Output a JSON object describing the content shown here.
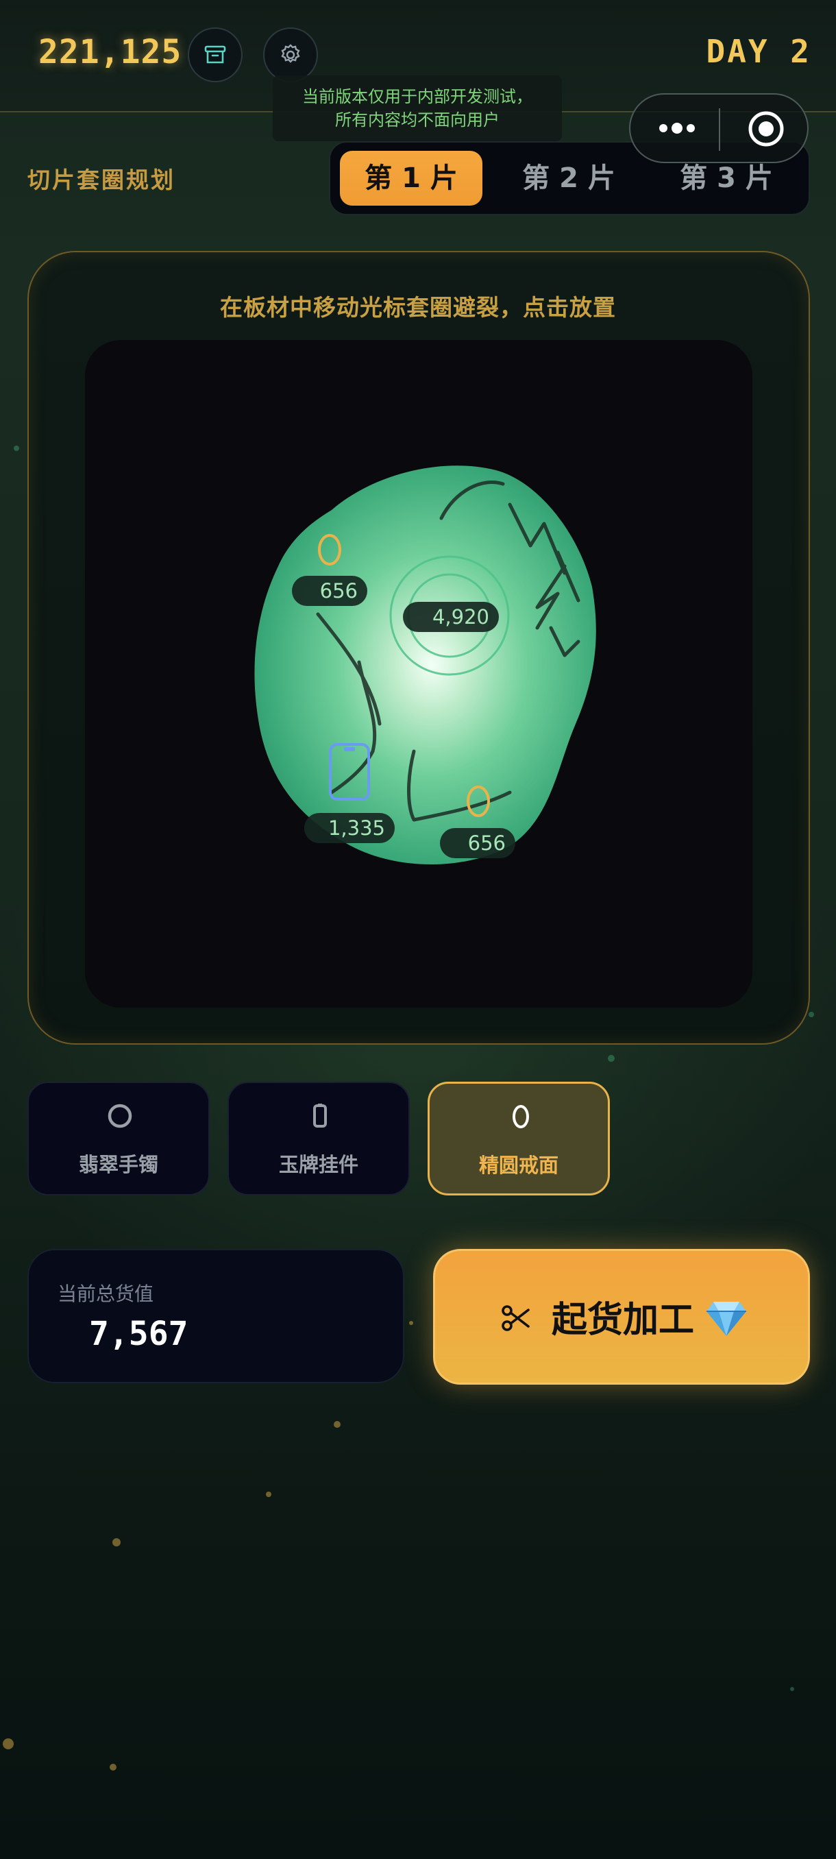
{
  "header": {
    "coins": "221,125",
    "day": "DAY 2",
    "dev_notice_line1": "当前版本仅用于内部开发测试，",
    "dev_notice_line2": "所有内容均不面向用户",
    "icons": [
      "archive-box-icon",
      "gear-icon",
      "more-dots-icon",
      "close-target-icon"
    ]
  },
  "planner": {
    "section_label": "切片套圈规划",
    "tabs": [
      {
        "label": "第 1 片",
        "active": true
      },
      {
        "label": "第 2 片",
        "active": false
      },
      {
        "label": "第 3 片",
        "active": false
      }
    ]
  },
  "board": {
    "instruction": "在板材中移动光标套圈避裂，点击放置",
    "placed_items": [
      {
        "type": "ring",
        "value": "656"
      },
      {
        "type": "bangle",
        "value": "4,920"
      },
      {
        "type": "pendant",
        "value": "1,335"
      },
      {
        "type": "ring",
        "value": "656"
      }
    ]
  },
  "tools": [
    {
      "label": "翡翠手镯",
      "icon": "bangle-icon",
      "active": false
    },
    {
      "label": "玉牌挂件",
      "icon": "pendant-icon",
      "active": false
    },
    {
      "label": "精圆戒面",
      "icon": "ring-icon",
      "active": true
    }
  ],
  "summary": {
    "total_value_label": "当前总货值",
    "total_value": "7,567"
  },
  "action": {
    "process_label": "起货加工",
    "icons": [
      "scissors-icon",
      "gem-icon"
    ]
  },
  "colors": {
    "accent_gold": "#f3c85a",
    "tab_active": "#f5a73e",
    "jade_green": "#4ec28a",
    "notice_green": "#7fd67a"
  }
}
